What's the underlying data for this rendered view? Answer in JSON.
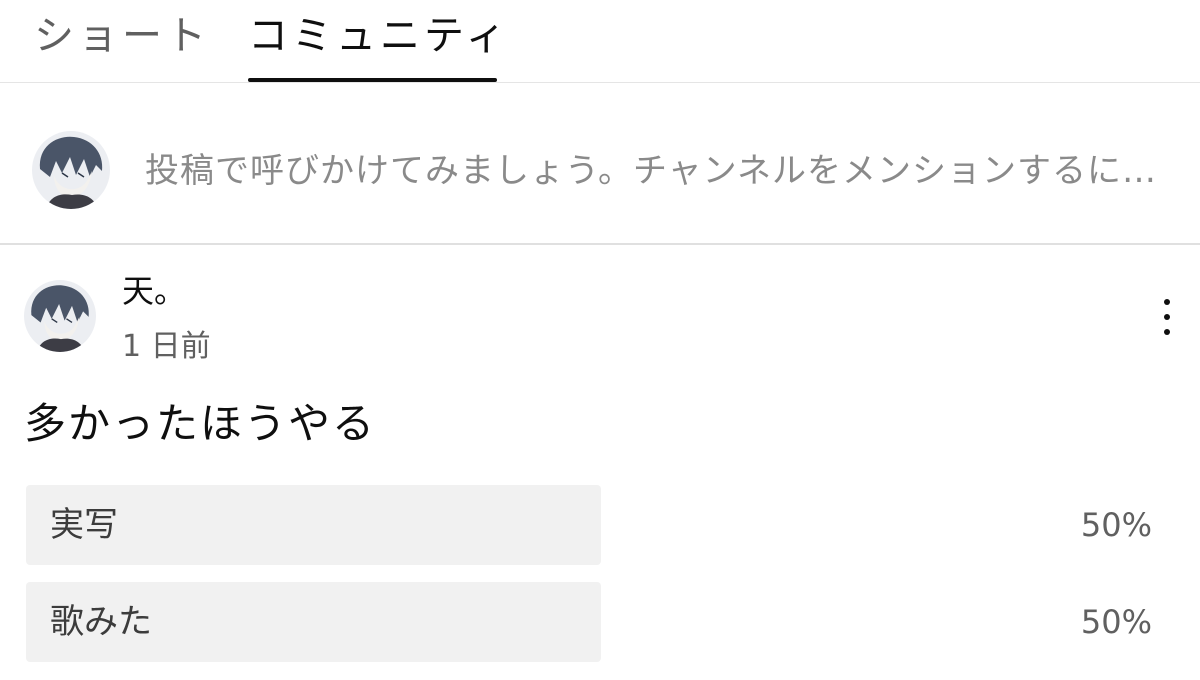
{
  "tabs": [
    {
      "label": "ショート",
      "active": false
    },
    {
      "label": "コミュニティ",
      "active": true
    }
  ],
  "composer": {
    "placeholder": "投稿で呼びかけてみましょう。チャンネルをメンションするに…"
  },
  "post": {
    "author": "天。",
    "time": "1 日前",
    "text": "多かったほうやる",
    "poll": {
      "options": [
        {
          "label": "実写",
          "percent": "50%",
          "fraction": 0.5
        },
        {
          "label": "歌みた",
          "percent": "50%",
          "fraction": 0.5
        }
      ]
    }
  },
  "icons": {
    "avatar": "user-avatar-anime-illustration",
    "menu": "more-vertical-icon"
  },
  "colors": {
    "text_primary": "#0f0f0f",
    "text_secondary": "#606060",
    "poll_fill": "#f1f1f1",
    "divider": "#e5e5e5"
  }
}
